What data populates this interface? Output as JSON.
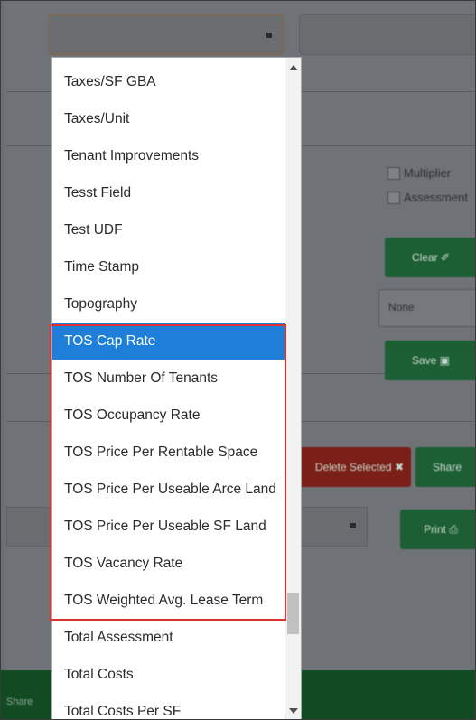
{
  "dropdown": {
    "options": [
      {
        "label": "Taxes/SF GBA"
      },
      {
        "label": "Taxes/Unit"
      },
      {
        "label": "Tenant Improvements"
      },
      {
        "label": "Tesst Field"
      },
      {
        "label": "Test UDF"
      },
      {
        "label": "Time Stamp"
      },
      {
        "label": "Topography"
      },
      {
        "label": "TOS Cap Rate",
        "selected": true
      },
      {
        "label": "TOS Number Of Tenants"
      },
      {
        "label": "TOS Occupancy Rate"
      },
      {
        "label": "TOS Price Per Rentable Space"
      },
      {
        "label": "TOS Price Per Useable Arce Land"
      },
      {
        "label": "TOS Price Per Useable SF Land"
      },
      {
        "label": "TOS Vacancy Rate"
      },
      {
        "label": "TOS Weighted Avg. Lease Term"
      },
      {
        "label": "Total Assessment"
      },
      {
        "label": "Total Costs"
      },
      {
        "label": "Total Costs Per SF"
      }
    ]
  },
  "background": {
    "checkbox_1": "Multiplier",
    "checkbox_2": "Assessment",
    "clear_button": "Clear",
    "none_select": "None",
    "save_button": "Save",
    "delete_selected_button": "Delete Selected",
    "share_button": "Share",
    "print_button": "Print",
    "footer_text": "Share"
  },
  "colors": {
    "selected": "#1e7fd8",
    "highlight_border": "#e0302f",
    "green_button": "#1d5f34",
    "red_button": "#7a2018"
  }
}
